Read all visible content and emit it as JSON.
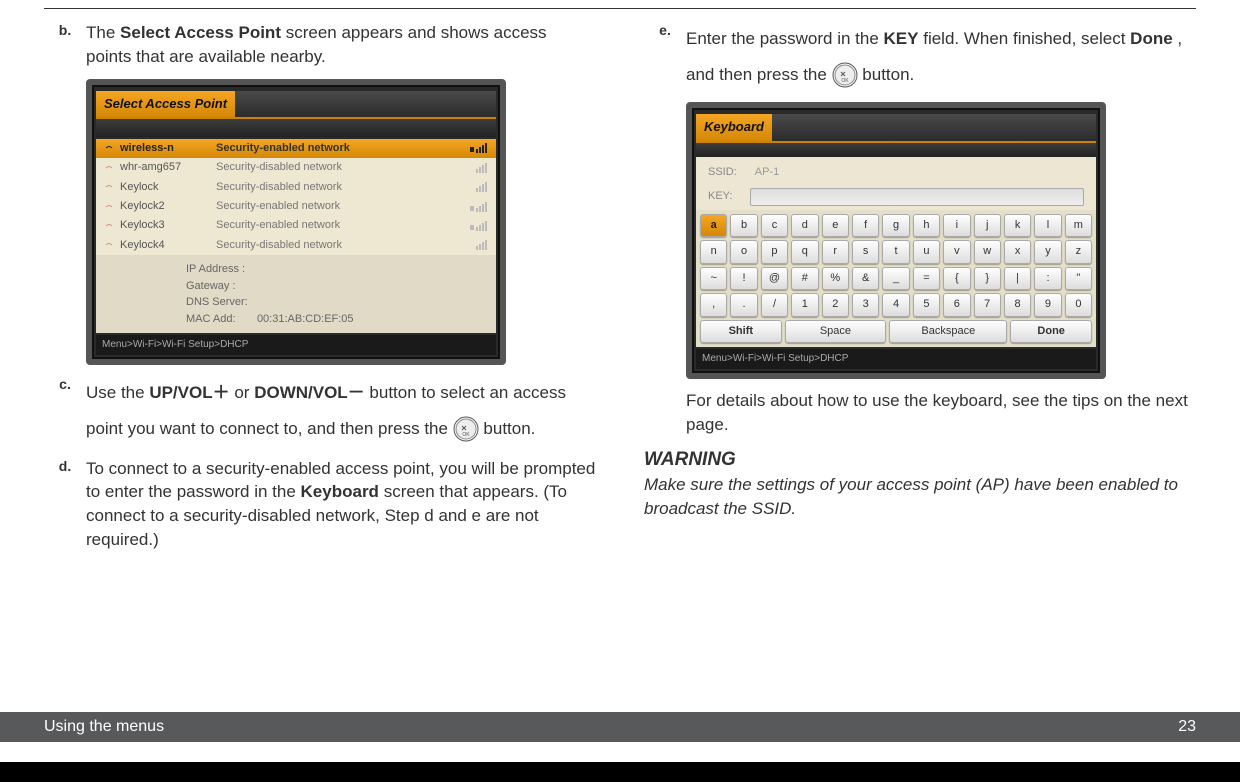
{
  "left": {
    "b": {
      "label": "b.",
      "t1": "The ",
      "bold1": "Select Access Point",
      "t2": " screen appears and shows access points that are available nearby."
    },
    "fig": {
      "title": "Select Access Point",
      "rows": [
        {
          "ssid": "wireless-n",
          "sec": "Security-enabled network"
        },
        {
          "ssid": "whr-amg657",
          "sec": "Security-disabled network"
        },
        {
          "ssid": "Keylock",
          "sec": "Security-disabled network"
        },
        {
          "ssid": "Keylock2",
          "sec": "Security-enabled network"
        },
        {
          "ssid": "Keylock3",
          "sec": "Security-enabled network"
        },
        {
          "ssid": "Keylock4",
          "sec": "Security-disabled network"
        }
      ],
      "info": {
        "ip": "IP Address :",
        "gw": "Gateway :",
        "dns": "DNS Server:",
        "mac_l": "MAC Add:",
        "mac_v": "00:31:AB:CD:EF:05"
      },
      "crumb": "Menu>Wi-Fi>Wi-Fi Setup>DHCP"
    },
    "c": {
      "label": "c.",
      "t1": "Use the ",
      "bold1": "UP/VOL＋",
      "t2": " or ",
      "bold2": "DOWN/VOL－",
      "t3": " button to select an access point you want to connect to, and then press the ",
      "t4": " button."
    },
    "d": {
      "label": "d.",
      "t1": "To connect to a security-enabled access point, you will be prompted to enter the password in the ",
      "bold1": "Keyboard",
      "t2": " screen that appears. (To connect to a security-disabled network, Step d and e are not required.)"
    }
  },
  "right": {
    "e": {
      "label": "e.",
      "t1": "Enter the password in the ",
      "bold1": "KEY",
      "t2": " field. When finished, select ",
      "bold2": "Done",
      "t3": ", and then press the ",
      "t4": " button."
    },
    "fig": {
      "title": "Keyboard",
      "ssid_l": "SSID:",
      "ssid_v": "AP-1",
      "key_l": "KEY:",
      "keys": {
        "r1": [
          "a",
          "b",
          "c",
          "d",
          "e",
          "f",
          "g",
          "h",
          "i",
          "j",
          "k",
          "l",
          "m"
        ],
        "r2": [
          "n",
          "o",
          "p",
          "q",
          "r",
          "s",
          "t",
          "u",
          "v",
          "w",
          "x",
          "y",
          "z"
        ],
        "r3": [
          "~",
          "!",
          "@",
          "#",
          "%",
          "&",
          "_",
          "=",
          "{",
          "}",
          "|",
          ":",
          "\""
        ],
        "r4": [
          ",",
          ".",
          "/",
          "1",
          "2",
          "3",
          "4",
          "5",
          "6",
          "7",
          "8",
          "9",
          "0"
        ],
        "r5": [
          "Shift",
          "Space",
          "Backspace",
          "Done"
        ]
      },
      "crumb": "Menu>Wi-Fi>Wi-Fi Setup>DHCP"
    },
    "note": "For details about how to use the keyboard, see the tips on the next page.",
    "warn": {
      "h": "WARNING",
      "t": "Make sure the settings of your access point (AP) have been enabled to broadcast the SSID."
    }
  },
  "footer": {
    "title": "Using the menus",
    "page": "23"
  }
}
